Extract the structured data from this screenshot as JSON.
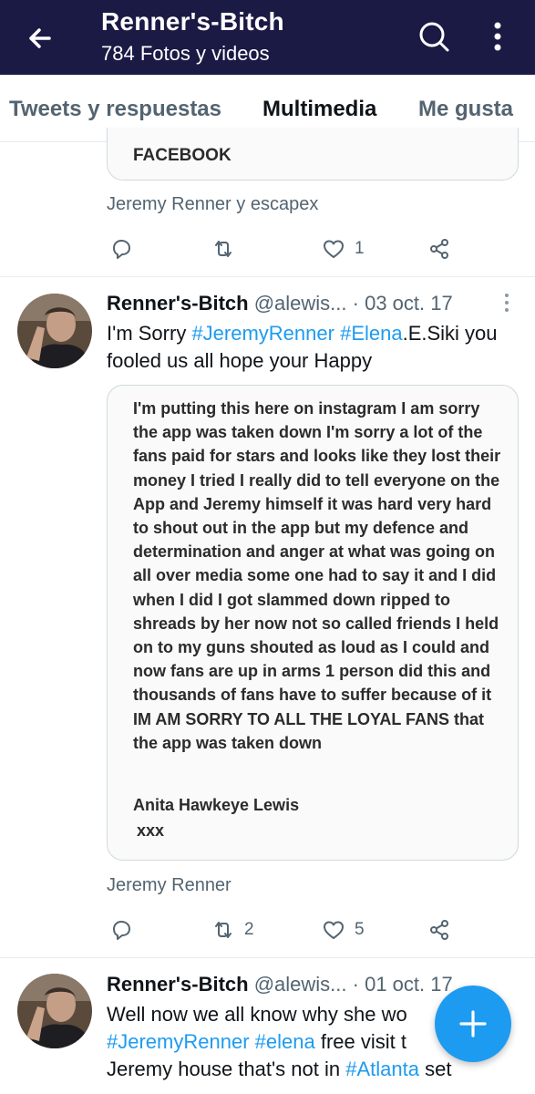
{
  "header": {
    "title": "Renner's-Bitch",
    "subtitle": "784 Fotos y videos"
  },
  "tabs": [
    {
      "label": "Tweets y respuestas",
      "active": false
    },
    {
      "label": "Multimedia",
      "active": true
    },
    {
      "label": "Me gusta",
      "active": false
    }
  ],
  "colors": {
    "header_bg": "#1b1a45",
    "accent": "#1d9bf0",
    "muted": "#536471"
  },
  "prev_tweet": {
    "card_text": "FACEBOOK",
    "tagged": "Jeremy Renner y escapex",
    "likes": "1"
  },
  "tweet1": {
    "name": "Renner's-Bitch",
    "handle": "@alewis...",
    "date": "· 03 oct. 17",
    "text_prefix": "I'm Sorry ",
    "tag1": "#JeremyRenner",
    "tag2": "#Elena",
    "text_suffix": ".E.Siki you fooled us all hope your Happy",
    "image_text": "I'm putting this here on instagram I am sorry the app was taken down I'm sorry a lot of the fans paid for stars and looks like they lost their money I tried I really did to tell everyone on the App and Jeremy himself it was hard very hard to shout out in the app but my defence and determination and anger at what was going on all over media some one had to say it and I did when I did I got slammed down ripped to shreads by her now not so called friends I held on to my guns shouted as loud as I could and now fans are up in arms 1 person did this and thousands of fans have to suffer because of it IM AM SORRY TO ALL THE LOYAL FANS that the app was taken down",
    "image_signature": "Anita Hawkeye Lewis",
    "image_sig2": "xxx",
    "tagged": "Jeremy Renner",
    "retweets": "2",
    "likes": "5"
  },
  "tweet2": {
    "name": "Renner's-Bitch",
    "handle": "@alewis...",
    "date": "· 01 oct. 17",
    "line1": "Well now we all know why she wo",
    "tag1": "#JeremyRenner",
    "tag2": "#elena",
    "line2_rest": " free visit t",
    "line3_start": "Jeremy house that's not in ",
    "tag3": "#Atlanta",
    "line3_end": " set"
  },
  "icons": [
    "back-arrow-icon",
    "search-icon",
    "more-vertical-icon",
    "reply-icon",
    "retweet-icon",
    "like-icon",
    "share-icon",
    "compose-plus-icon"
  ]
}
